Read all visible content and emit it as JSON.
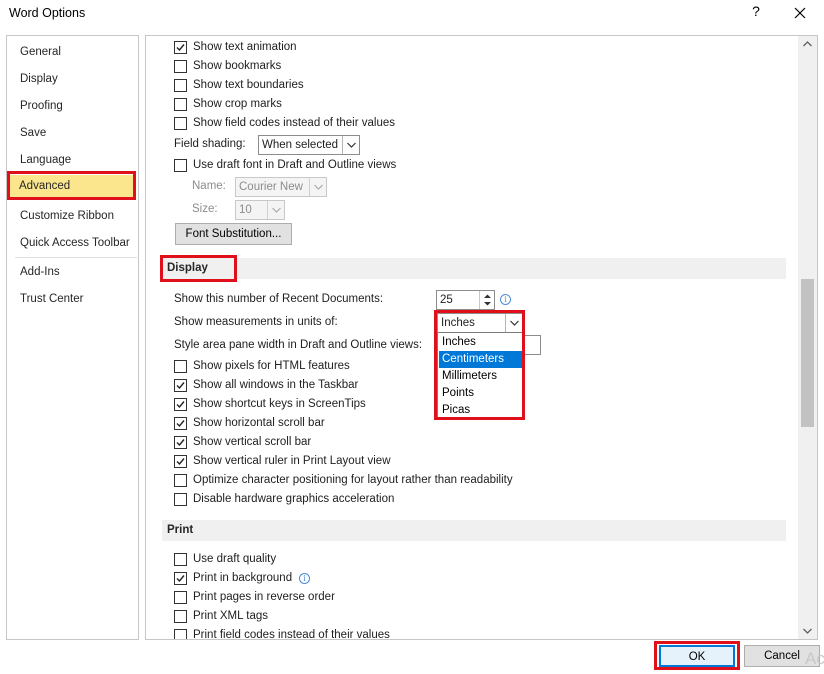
{
  "window": {
    "title": "Word Options",
    "help_icon": "?",
    "close_icon": "close-icon"
  },
  "sidebar": {
    "items": [
      {
        "label": "General"
      },
      {
        "label": "Display"
      },
      {
        "label": "Proofing"
      },
      {
        "label": "Save"
      },
      {
        "label": "Language"
      },
      {
        "label": "Advanced",
        "selected": true
      },
      {
        "label": "Customize Ribbon"
      },
      {
        "label": "Quick Access Toolbar"
      },
      {
        "label": "Add-Ins"
      },
      {
        "label": "Trust Center"
      }
    ]
  },
  "show_doc": {
    "options": [
      {
        "label": "Show text animation",
        "checked": true
      },
      {
        "label": "Show bookmarks",
        "checked": false
      },
      {
        "label": "Show text boundaries",
        "checked": false
      },
      {
        "label": "Show crop marks",
        "checked": false
      },
      {
        "label": "Show field codes instead of their values",
        "checked": false
      }
    ],
    "field_shading_label": "Field shading:",
    "field_shading_value": "When selected",
    "draft_font": {
      "label": "Use draft font in Draft and Outline views",
      "checked": false
    },
    "name_label": "Name:",
    "name_value": "Courier New",
    "size_label": "Size:",
    "size_value": "10",
    "font_substitution_button": "Font Substitution..."
  },
  "display": {
    "header": "Display",
    "recent_docs_label": "Show this number of Recent Documents:",
    "recent_docs_value": "25",
    "measurements_label": "Show measurements in units of:",
    "measurements_value": "Inches",
    "measurement_options": [
      "Inches",
      "Centimeters",
      "Millimeters",
      "Points",
      "Picas"
    ],
    "highlighted_option": "Centimeters",
    "style_area_label": "Style area pane width in Draft and Outline views:",
    "options": [
      {
        "label": "Show pixels for HTML features",
        "checked": false
      },
      {
        "label": "Show all windows in the Taskbar",
        "checked": true
      },
      {
        "label": "Show shortcut keys in ScreenTips",
        "checked": true
      },
      {
        "label": "Show horizontal scroll bar",
        "checked": true
      },
      {
        "label": "Show vertical scroll bar",
        "checked": true
      },
      {
        "label": "Show vertical ruler in Print Layout view",
        "checked": true
      },
      {
        "label": "Optimize character positioning for layout rather than readability",
        "checked": false
      },
      {
        "label": "Disable hardware graphics acceleration",
        "checked": false
      }
    ]
  },
  "print": {
    "header": "Print",
    "options": [
      {
        "label": "Use draft quality",
        "checked": false
      },
      {
        "label": "Print in background",
        "checked": true
      },
      {
        "label": "Print pages in reverse order",
        "checked": false
      },
      {
        "label": "Print XML tags",
        "checked": false
      },
      {
        "label": "Print field codes instead of their values",
        "checked": false
      }
    ]
  },
  "footer": {
    "ok_label": "OK",
    "cancel_label": "Cancel",
    "watermark": "Ac"
  },
  "colors": {
    "selected_nav": "#fbe58d",
    "highlight": "#0078d7",
    "annotation_red": "#e0101b"
  }
}
